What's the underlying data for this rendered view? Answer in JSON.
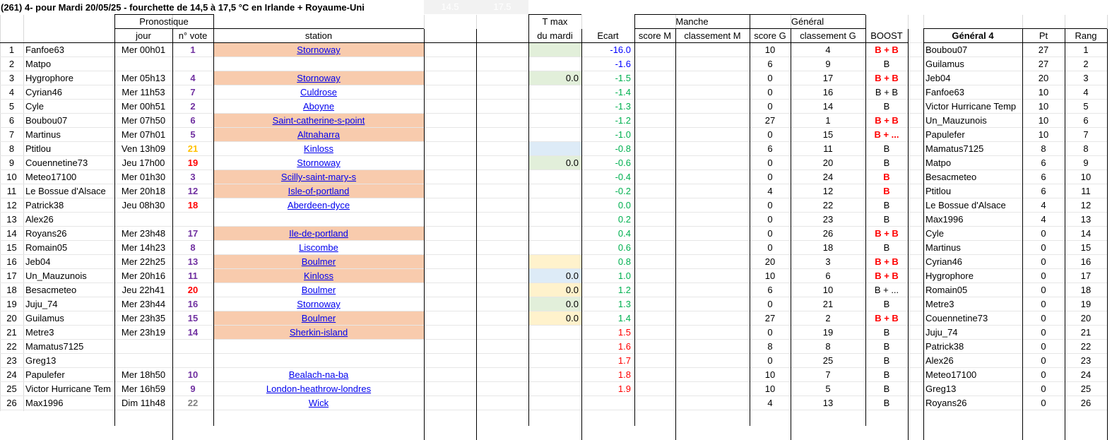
{
  "title": "(261) 4- pour Mardi 20/05/25 - fourchette de 14,5 à 17,5 °C en Irlande + Royaume-Uni",
  "range_low": "14.5",
  "range_high": "17.5",
  "headers": {
    "pronostique": "Pronostique",
    "jour": "jour",
    "vote": "n° vote",
    "station": "station",
    "tmax1": "T max",
    "tmax2": "du mardi",
    "ecart": "Ecart",
    "manche": "Manche",
    "score_m": "score M",
    "classement_m": "classement M",
    "general": "Général",
    "score_g": "score G",
    "classement_g": "classement G",
    "boost": "BOOST",
    "general4": "Général 4",
    "pt": "Pt",
    "rang": "Rang"
  },
  "colors": {
    "orange_fill": "#f8cbad",
    "green_fill": "#e2efda",
    "yellow_fill": "#fff2cc",
    "blue_fill": "#ddebf7",
    "purple": "#7030a0",
    "red": "#ff0000",
    "orange": "#ffc000",
    "grey": "#808080",
    "ecart_blue": "#0000ff",
    "ecart_green": "#00b050",
    "link": "#0000ee"
  },
  "rows": [
    {
      "n": "1",
      "name": "Fanfoe63",
      "jour": "Mer 00h01",
      "vote": "1",
      "vote_color": "purple",
      "station": "Stornoway",
      "station_fill": "orange",
      "tmax": "",
      "tmax_fill": "green",
      "ecart": "-16.0",
      "ecart_color": "blue",
      "score_g": "10",
      "class_g": "4",
      "boost": "B + B",
      "boost_red": true,
      "g4_name": "Boubou07",
      "g4_pt": "27",
      "g4_rang": "1"
    },
    {
      "n": "2",
      "name": "Matpo",
      "jour": "",
      "vote": "",
      "vote_color": "",
      "station": "",
      "station_fill": "",
      "tmax": "",
      "tmax_fill": "",
      "ecart": "-1.6",
      "ecart_color": "blue",
      "score_g": "6",
      "class_g": "9",
      "boost": "B",
      "boost_red": false,
      "g4_name": "Guilamus",
      "g4_pt": "27",
      "g4_rang": "2"
    },
    {
      "n": "3",
      "name": "Hygrophore",
      "jour": "Mer 05h13",
      "vote": "4",
      "vote_color": "purple",
      "station": "Stornoway",
      "station_fill": "orange",
      "tmax": "0.0",
      "tmax_fill": "green",
      "ecart": "-1.5",
      "ecart_color": "green",
      "score_g": "0",
      "class_g": "17",
      "boost": "B + B",
      "boost_red": true,
      "g4_name": "Jeb04",
      "g4_pt": "20",
      "g4_rang": "3"
    },
    {
      "n": "4",
      "name": "Cyrian46",
      "jour": "Mer 11h53",
      "vote": "7",
      "vote_color": "purple",
      "station": "Culdrose",
      "station_fill": "",
      "tmax": "",
      "tmax_fill": "",
      "ecart": "-1.4",
      "ecart_color": "green",
      "score_g": "0",
      "class_g": "16",
      "boost": "B + B",
      "boost_red": false,
      "g4_name": "Fanfoe63",
      "g4_pt": "10",
      "g4_rang": "4"
    },
    {
      "n": "5",
      "name": "Cyle",
      "jour": "Mer 00h51",
      "vote": "2",
      "vote_color": "purple",
      "station": "Aboyne",
      "station_fill": "",
      "tmax": "",
      "tmax_fill": "",
      "ecart": "-1.3",
      "ecart_color": "green",
      "score_g": "0",
      "class_g": "14",
      "boost": "B",
      "boost_red": false,
      "g4_name": "Victor Hurricane Temp",
      "g4_pt": "10",
      "g4_rang": "5"
    },
    {
      "n": "6",
      "name": "Boubou07",
      "jour": "Mer 07h50",
      "vote": "6",
      "vote_color": "purple",
      "station": "Saint-catherine-s-point",
      "station_fill": "orange",
      "tmax": "",
      "tmax_fill": "",
      "ecart": "-1.2",
      "ecart_color": "green",
      "score_g": "27",
      "class_g": "1",
      "boost": "B + B",
      "boost_red": true,
      "g4_name": "Un_Mauzunois",
      "g4_pt": "10",
      "g4_rang": "6"
    },
    {
      "n": "7",
      "name": "Martinus",
      "jour": "Mer 07h01",
      "vote": "5",
      "vote_color": "purple",
      "station": "Altnaharra",
      "station_fill": "orange",
      "tmax": "",
      "tmax_fill": "",
      "ecart": "-1.0",
      "ecart_color": "green",
      "score_g": "0",
      "class_g": "15",
      "boost": "B + ...",
      "boost_red": true,
      "g4_name": "Papulefer",
      "g4_pt": "10",
      "g4_rang": "7"
    },
    {
      "n": "8",
      "name": "Ptitlou",
      "jour": "Ven 13h09",
      "vote": "21",
      "vote_color": "orange",
      "station": "Kinloss",
      "station_fill": "",
      "tmax": "",
      "tmax_fill": "blue",
      "ecart": "-0.8",
      "ecart_color": "green",
      "score_g": "6",
      "class_g": "11",
      "boost": "B",
      "boost_red": false,
      "g4_name": "Mamatus7125",
      "g4_pt": "8",
      "g4_rang": "8"
    },
    {
      "n": "9",
      "name": "Couennetine73",
      "jour": "Jeu 17h00",
      "vote": "19",
      "vote_color": "red",
      "station": "Stornoway",
      "station_fill": "",
      "tmax": "0.0",
      "tmax_fill": "green",
      "ecart": "-0.6",
      "ecart_color": "green",
      "score_g": "0",
      "class_g": "20",
      "boost": "B",
      "boost_red": false,
      "g4_name": "Matpo",
      "g4_pt": "6",
      "g4_rang": "9"
    },
    {
      "n": "10",
      "name": "Meteo17100",
      "jour": "Mer 01h30",
      "vote": "3",
      "vote_color": "purple",
      "station": "Scilly-saint-mary-s",
      "station_fill": "orange",
      "tmax": "",
      "tmax_fill": "",
      "ecart": "-0.4",
      "ecart_color": "green",
      "score_g": "0",
      "class_g": "24",
      "boost": "B",
      "boost_red": true,
      "g4_name": "Besacmeteo",
      "g4_pt": "6",
      "g4_rang": "10"
    },
    {
      "n": "11",
      "name": "Le Bossue d'Alsace",
      "jour": "Mer 20h18",
      "vote": "12",
      "vote_color": "purple",
      "station": "Isle-of-portland",
      "station_fill": "orange",
      "tmax": "",
      "tmax_fill": "",
      "ecart": "-0.2",
      "ecart_color": "green",
      "score_g": "4",
      "class_g": "12",
      "boost": "B",
      "boost_red": true,
      "g4_name": "Ptitlou",
      "g4_pt": "6",
      "g4_rang": "11"
    },
    {
      "n": "12",
      "name": "Patrick38",
      "jour": "Jeu 08h30",
      "vote": "18",
      "vote_color": "red",
      "station": "Aberdeen-dyce",
      "station_fill": "",
      "tmax": "",
      "tmax_fill": "",
      "ecart": "0.0",
      "ecart_color": "green",
      "score_g": "0",
      "class_g": "22",
      "boost": "B",
      "boost_red": false,
      "g4_name": "Le Bossue d'Alsace",
      "g4_pt": "4",
      "g4_rang": "12"
    },
    {
      "n": "13",
      "name": "Alex26",
      "jour": "",
      "vote": "",
      "vote_color": "",
      "station": "",
      "station_fill": "",
      "tmax": "",
      "tmax_fill": "",
      "ecart": "0.2",
      "ecart_color": "green",
      "score_g": "0",
      "class_g": "23",
      "boost": "B",
      "boost_red": false,
      "g4_name": "Max1996",
      "g4_pt": "4",
      "g4_rang": "13"
    },
    {
      "n": "14",
      "name": "Royans26",
      "jour": "Mer 23h48",
      "vote": "17",
      "vote_color": "purple",
      "station": "Ile-de-portland",
      "station_fill": "orange",
      "tmax": "",
      "tmax_fill": "",
      "ecart": "0.4",
      "ecart_color": "green",
      "score_g": "0",
      "class_g": "26",
      "boost": "B + B",
      "boost_red": true,
      "g4_name": "Cyle",
      "g4_pt": "0",
      "g4_rang": "14"
    },
    {
      "n": "15",
      "name": "Romain05",
      "jour": "Mer 14h23",
      "vote": "8",
      "vote_color": "purple",
      "station": "Liscombe",
      "station_fill": "",
      "tmax": "",
      "tmax_fill": "",
      "ecart": "0.6",
      "ecart_color": "green",
      "score_g": "0",
      "class_g": "18",
      "boost": "B",
      "boost_red": false,
      "g4_name": "Martinus",
      "g4_pt": "0",
      "g4_rang": "15"
    },
    {
      "n": "16",
      "name": "Jeb04",
      "jour": "Mer 22h25",
      "vote": "13",
      "vote_color": "purple",
      "station": "Boulmer",
      "station_fill": "orange",
      "tmax": "",
      "tmax_fill": "yellow",
      "ecart": "0.8",
      "ecart_color": "green",
      "score_g": "20",
      "class_g": "3",
      "boost": "B + B",
      "boost_red": true,
      "g4_name": "Cyrian46",
      "g4_pt": "0",
      "g4_rang": "16"
    },
    {
      "n": "17",
      "name": "Un_Mauzunois",
      "jour": "Mer 20h16",
      "vote": "11",
      "vote_color": "purple",
      "station": "Kinloss",
      "station_fill": "orange",
      "tmax": "0.0",
      "tmax_fill": "blue",
      "ecart": "1.0",
      "ecart_color": "green",
      "score_g": "10",
      "class_g": "6",
      "boost": "B + B",
      "boost_red": true,
      "g4_name": "Hygrophore",
      "g4_pt": "0",
      "g4_rang": "17"
    },
    {
      "n": "18",
      "name": "Besacmeteo",
      "jour": "Jeu 22h41",
      "vote": "20",
      "vote_color": "red",
      "station": "Boulmer",
      "station_fill": "",
      "tmax": "0.0",
      "tmax_fill": "yellow",
      "ecart": "1.2",
      "ecart_color": "green",
      "score_g": "6",
      "class_g": "10",
      "boost": "B + ...",
      "boost_red": false,
      "g4_name": "Romain05",
      "g4_pt": "0",
      "g4_rang": "18"
    },
    {
      "n": "19",
      "name": "Juju_74",
      "jour": "Mer 23h44",
      "vote": "16",
      "vote_color": "purple",
      "station": "Stornoway",
      "station_fill": "",
      "tmax": "0.0",
      "tmax_fill": "green",
      "ecart": "1.3",
      "ecart_color": "green",
      "score_g": "0",
      "class_g": "21",
      "boost": "B",
      "boost_red": false,
      "g4_name": "Metre3",
      "g4_pt": "0",
      "g4_rang": "19"
    },
    {
      "n": "20",
      "name": "Guilamus",
      "jour": "Mer 23h35",
      "vote": "15",
      "vote_color": "purple",
      "station": "Boulmer",
      "station_fill": "orange",
      "tmax": "0.0",
      "tmax_fill": "yellow",
      "ecart": "1.4",
      "ecart_color": "green",
      "score_g": "27",
      "class_g": "2",
      "boost": "B + B",
      "boost_red": true,
      "g4_name": "Couennetine73",
      "g4_pt": "0",
      "g4_rang": "20"
    },
    {
      "n": "21",
      "name": "Metre3",
      "jour": "Mer 23h19",
      "vote": "14",
      "vote_color": "purple",
      "station": "Sherkin-island",
      "station_fill": "orange",
      "tmax": "",
      "tmax_fill": "",
      "ecart": "1.5",
      "ecart_color": "red",
      "score_g": "0",
      "class_g": "19",
      "boost": "B",
      "boost_red": false,
      "g4_name": "Juju_74",
      "g4_pt": "0",
      "g4_rang": "21"
    },
    {
      "n": "22",
      "name": "Mamatus7125",
      "jour": "",
      "vote": "",
      "vote_color": "",
      "station": "",
      "station_fill": "",
      "tmax": "",
      "tmax_fill": "",
      "ecart": "1.6",
      "ecart_color": "red",
      "score_g": "8",
      "class_g": "8",
      "boost": "B",
      "boost_red": false,
      "g4_name": "Patrick38",
      "g4_pt": "0",
      "g4_rang": "22"
    },
    {
      "n": "23",
      "name": "Greg13",
      "jour": "",
      "vote": "",
      "vote_color": "",
      "station": "",
      "station_fill": "",
      "tmax": "",
      "tmax_fill": "",
      "ecart": "1.7",
      "ecart_color": "red",
      "score_g": "0",
      "class_g": "25",
      "boost": "B",
      "boost_red": false,
      "g4_name": "Alex26",
      "g4_pt": "0",
      "g4_rang": "23"
    },
    {
      "n": "24",
      "name": "Papulefer",
      "jour": "Mer 18h50",
      "vote": "10",
      "vote_color": "purple",
      "station": "Bealach-na-ba",
      "station_fill": "",
      "tmax": "",
      "tmax_fill": "",
      "ecart": "1.8",
      "ecart_color": "red",
      "score_g": "10",
      "class_g": "7",
      "boost": "B",
      "boost_red": false,
      "g4_name": "Meteo17100",
      "g4_pt": "0",
      "g4_rang": "24"
    },
    {
      "n": "25",
      "name": "Victor Hurricane Tem",
      "jour": "Mer 16h59",
      "vote": "9",
      "vote_color": "purple",
      "station": "London-heathrow-londres",
      "station_fill": "",
      "tmax": "",
      "tmax_fill": "",
      "ecart": "1.9",
      "ecart_color": "red",
      "score_g": "10",
      "class_g": "5",
      "boost": "B",
      "boost_red": false,
      "g4_name": "Greg13",
      "g4_pt": "0",
      "g4_rang": "25"
    },
    {
      "n": "26",
      "name": "Max1996",
      "jour": "Dim 11h48",
      "vote": "22",
      "vote_color": "grey",
      "station": "Wick",
      "station_fill": "",
      "tmax": "",
      "tmax_fill": "",
      "ecart": "",
      "ecart_color": "",
      "score_g": "4",
      "class_g": "13",
      "boost": "B",
      "boost_red": false,
      "g4_name": "Royans26",
      "g4_pt": "0",
      "g4_rang": "26"
    }
  ]
}
